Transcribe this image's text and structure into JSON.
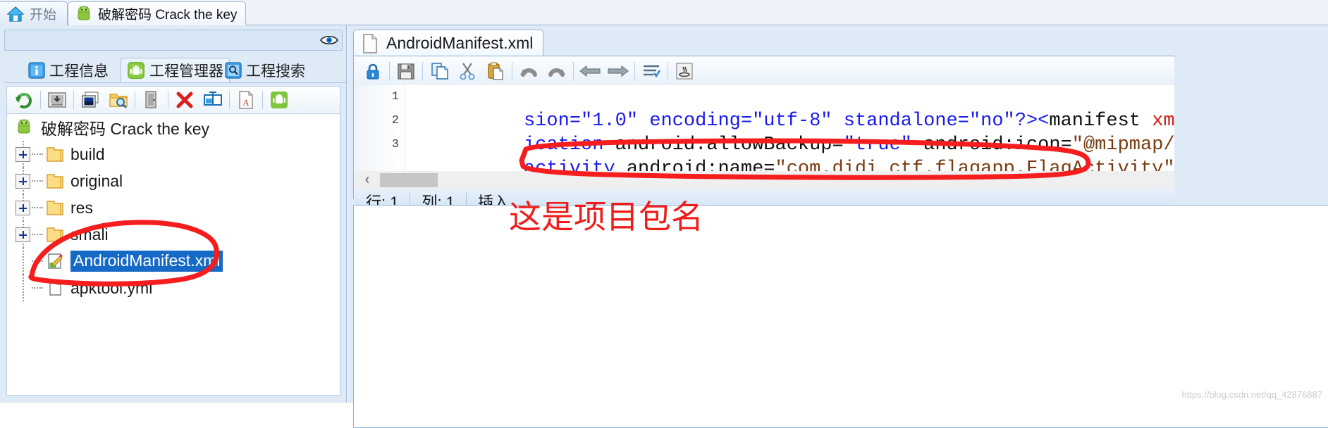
{
  "app_tabs": [
    {
      "label": "开始",
      "icon": "home-icon",
      "active": false
    },
    {
      "label": "破解密码 Crack the key",
      "icon": "android-icon",
      "active": true
    }
  ],
  "left_panel": {
    "eye_icon": "eye-icon",
    "sub_tabs": [
      {
        "label": "工程信息",
        "icon": "info-icon",
        "active": false
      },
      {
        "label": "工程管理器",
        "icon": "android-icon",
        "active": true
      },
      {
        "label": "工程搜索",
        "icon": "search-icon",
        "active": false
      }
    ],
    "toolbar": [
      {
        "name": "refresh-icon",
        "title": "刷新"
      },
      {
        "name": "install-icon",
        "title": "安装"
      },
      {
        "name": "image-icon",
        "title": "图片"
      },
      {
        "name": "folder-search-icon",
        "title": "查找目录"
      },
      {
        "name": "door-icon",
        "title": "打开"
      },
      {
        "name": "delete-icon",
        "title": "删除"
      },
      {
        "name": "layout-icon",
        "title": "布局"
      },
      {
        "name": "text-file-icon",
        "title": "文本"
      },
      {
        "name": "android-build-icon",
        "title": "编译"
      }
    ],
    "tree": {
      "root": {
        "label": "破解密码 Crack the key",
        "icon": "android-icon"
      },
      "children": [
        {
          "label": "build",
          "icon": "folder-icon",
          "expandable": true,
          "selected": false
        },
        {
          "label": "original",
          "icon": "folder-icon",
          "expandable": true,
          "selected": false
        },
        {
          "label": "res",
          "icon": "folder-icon",
          "expandable": true,
          "selected": false
        },
        {
          "label": "smali",
          "icon": "folder-icon",
          "expandable": true,
          "selected": false
        },
        {
          "label": "AndroidManifest.xml",
          "icon": "xml-edit-icon",
          "expandable": false,
          "selected": true
        },
        {
          "label": "apktool.yml",
          "icon": "file-icon",
          "expandable": false,
          "selected": false
        }
      ]
    }
  },
  "right_panel": {
    "editor_tab": {
      "label": "AndroidManifest.xml",
      "icon": "file-icon"
    },
    "toolbar": [
      {
        "name": "lock-icon",
        "title": "锁定"
      },
      {
        "name": "save-icon",
        "title": "保存"
      },
      {
        "name": "copy-icon",
        "title": "复制"
      },
      {
        "name": "cut-icon",
        "title": "剪切"
      },
      {
        "name": "paste-icon",
        "title": "粘贴"
      },
      {
        "name": "undo-icon",
        "title": "撤销"
      },
      {
        "name": "redo-icon",
        "title": "重做"
      },
      {
        "name": "back-icon",
        "title": "后退"
      },
      {
        "name": "forward-icon",
        "title": "前进"
      },
      {
        "name": "format-icon",
        "title": "格式化"
      },
      {
        "name": "java-icon",
        "title": "Java"
      }
    ],
    "code": {
      "lines": [
        {
          "num": "1",
          "segments": [
            {
              "text": "sion=",
              "cls": "tok-blue"
            },
            {
              "text": "\"1.0\"",
              "cls": "tok-blue"
            },
            {
              "text": " encoding=",
              "cls": "tok-blue"
            },
            {
              "text": "\"utf-8\"",
              "cls": "tok-blue"
            },
            {
              "text": " standalone=",
              "cls": "tok-blue"
            },
            {
              "text": "\"no\"",
              "cls": "tok-blue"
            },
            {
              "text": "?><",
              "cls": "tok-blue"
            },
            {
              "text": "manifest",
              "cls": "tok-dark"
            },
            {
              "text": " xmln",
              "cls": "tok-red"
            }
          ]
        },
        {
          "num": "2",
          "segments": [
            {
              "text": "ication",
              "cls": "tok-blue"
            },
            {
              "text": " android:allowBackup=",
              "cls": "tok-dark"
            },
            {
              "text": "\"true\"",
              "cls": "tok-blue"
            },
            {
              "text": " android:icon=",
              "cls": "tok-dark"
            },
            {
              "text": "\"@mipmap/ic",
              "cls": "tok-brn"
            }
          ]
        },
        {
          "num": "3",
          "segments": [
            {
              "text": "activity",
              "cls": "tok-blue"
            },
            {
              "text": " android:name=",
              "cls": "tok-dark"
            },
            {
              "text": "\"com.didi_ctf.flagapp.FlagActivity\"",
              "cls": "tok-brn"
            }
          ]
        }
      ]
    },
    "hscroll": {
      "left_arrow": "‹"
    },
    "status": {
      "row_label": "行: 1",
      "col_label": "列: 1",
      "mode_label": "插入"
    }
  },
  "annotations": {
    "note_text": "这是项目包名",
    "note_color": "#ef1c1c",
    "ink_color": "#f51d1d"
  },
  "watermark": "https://blog.csdn.net/qq_42876887"
}
